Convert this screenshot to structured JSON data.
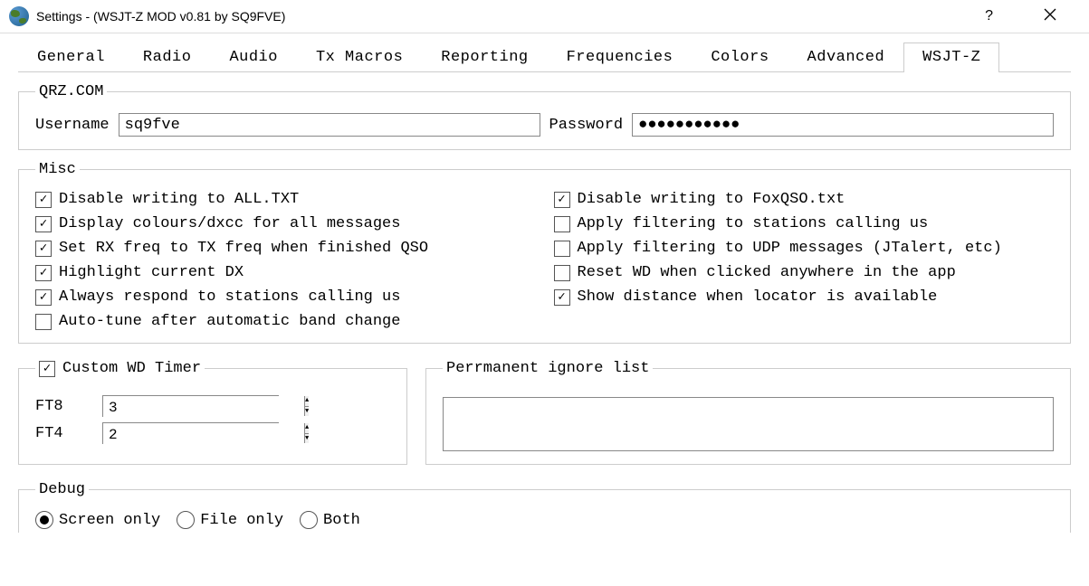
{
  "window": {
    "title": "Settings - (WSJT-Z MOD v0.81 by SQ9FVE)",
    "help": "?",
    "close": "×"
  },
  "tabs": {
    "items": [
      "General",
      "Radio",
      "Audio",
      "Tx Macros",
      "Reporting",
      "Frequencies",
      "Colors",
      "Advanced",
      "WSJT-Z"
    ],
    "active_index": 8
  },
  "qrz": {
    "legend": "QRZ.COM",
    "username_label": "Username",
    "username_value": "sq9fve",
    "password_label": "Password",
    "password_value": "●●●●●●●●●●●"
  },
  "misc": {
    "legend": "Misc",
    "options": [
      {
        "label": "Disable writing to ALL.TXT",
        "checked": true
      },
      {
        "label": "Disable writing to FoxQSO.txt",
        "checked": true
      },
      {
        "label": "Display colours/dxcc for all messages",
        "checked": true
      },
      {
        "label": "Apply filtering to stations calling us",
        "checked": false
      },
      {
        "label": "Set RX freq to TX freq when finished QSO",
        "checked": true
      },
      {
        "label": "Apply filtering to UDP messages (JTalert, etc)",
        "checked": false
      },
      {
        "label": "Highlight current DX",
        "checked": true
      },
      {
        "label": "Reset WD when clicked anywhere in the app",
        "checked": false
      },
      {
        "label": "Always respond to stations calling us",
        "checked": true
      },
      {
        "label": "Show distance when locator is available",
        "checked": true
      },
      {
        "label": "Auto-tune after automatic band change",
        "checked": false
      }
    ]
  },
  "wd_timer": {
    "legend": "Custom WD Timer",
    "legend_checked": true,
    "ft8_label": "FT8",
    "ft8_value": "3",
    "ft4_label": "FT4",
    "ft4_value": "2"
  },
  "ignore_list": {
    "legend": "Perrmanent ignore list"
  },
  "debug": {
    "legend": "Debug",
    "options": [
      {
        "label": "Screen only",
        "checked": true
      },
      {
        "label": "File only",
        "checked": false
      },
      {
        "label": "Both",
        "checked": false
      }
    ]
  }
}
